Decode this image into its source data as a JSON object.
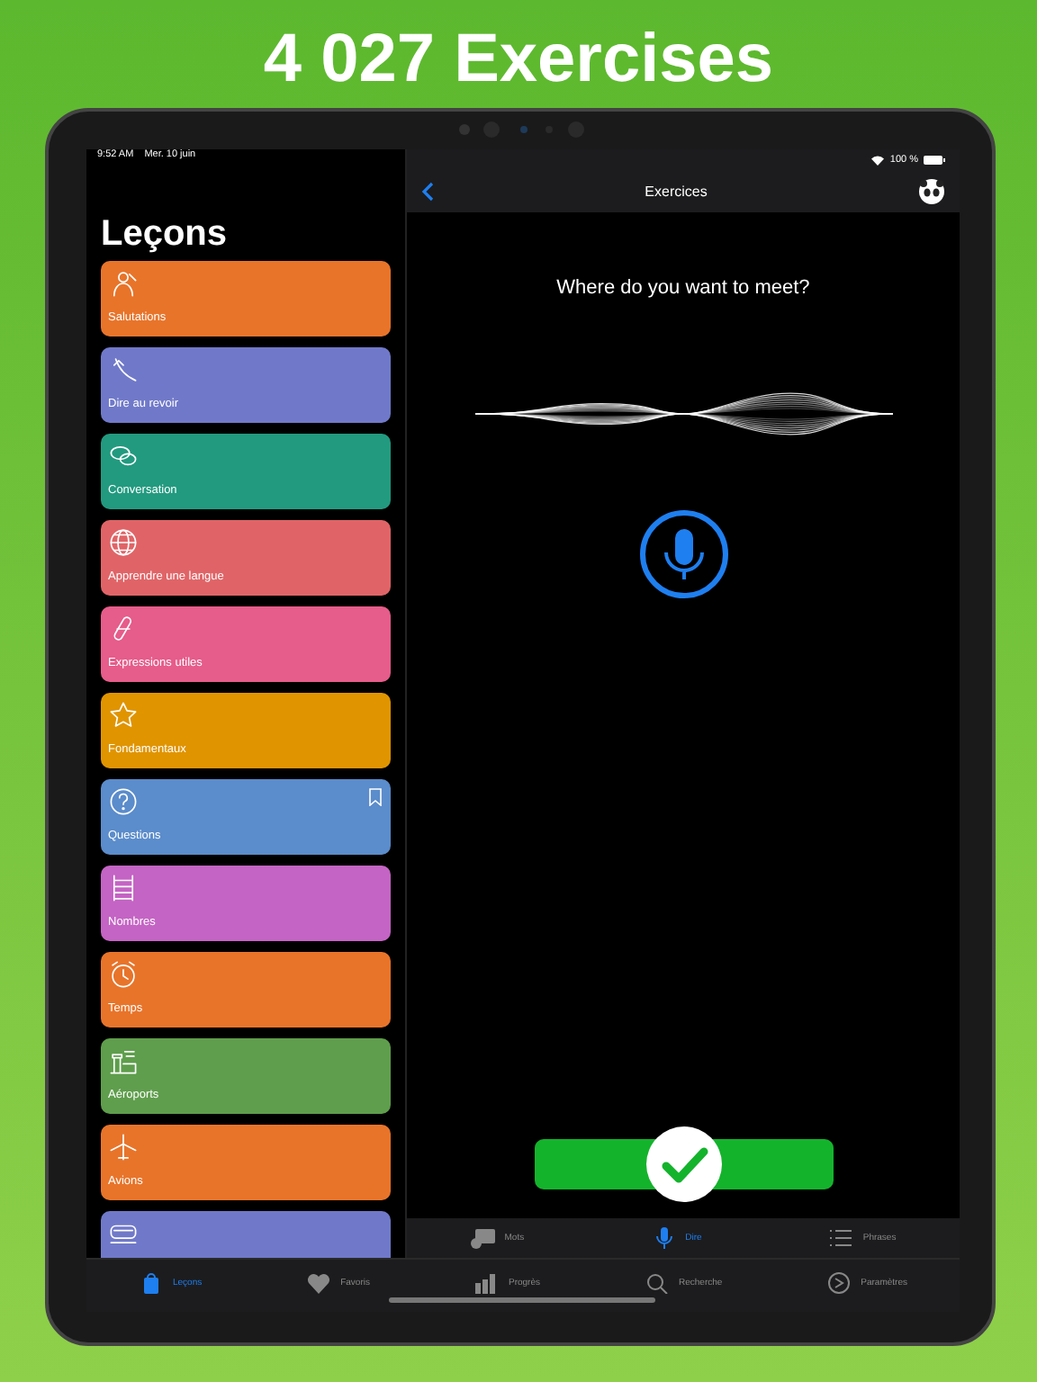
{
  "headline": "4 027 Exercises",
  "status_bar": {
    "time": "9:52 AM",
    "date": "Mer. 10 juin",
    "battery": "100 %"
  },
  "sidebar": {
    "title": "Leçons",
    "lessons": [
      {
        "label": "Salutations",
        "color": "#e8742a",
        "bookmarked": false
      },
      {
        "label": "Dire au revoir",
        "color": "#7079c9",
        "bookmarked": false
      },
      {
        "label": "Conversation",
        "color": "#229a7f",
        "bookmarked": false
      },
      {
        "label": "Apprendre une langue",
        "color": "#e06467",
        "bookmarked": false
      },
      {
        "label": "Expressions utiles",
        "color": "#e65c8a",
        "bookmarked": false
      },
      {
        "label": "Fondamentaux",
        "color": "#e09400",
        "bookmarked": false
      },
      {
        "label": "Questions",
        "color": "#5b8ccb",
        "bookmarked": true
      },
      {
        "label": "Nombres",
        "color": "#c464c4",
        "bookmarked": false
      },
      {
        "label": "Temps",
        "color": "#e8742a",
        "bookmarked": false
      },
      {
        "label": "Aéroports",
        "color": "#5f9e4c",
        "bookmarked": false
      },
      {
        "label": "Avions",
        "color": "#e8742a",
        "bookmarked": false
      },
      {
        "color": "#7079c9",
        "bookmarked": false
      }
    ]
  },
  "exercise": {
    "nav_title": "Exercices",
    "prompt": "Where do you want to meet?"
  },
  "mode_tabs": [
    {
      "label": "Mots",
      "selected": false
    },
    {
      "label": "Dire",
      "selected": true
    },
    {
      "label": "Phrases",
      "selected": false
    }
  ],
  "tab_bar": [
    {
      "label": "Leçons",
      "selected": true
    },
    {
      "label": "Favoris",
      "selected": false
    },
    {
      "label": "Progrès",
      "selected": false
    },
    {
      "label": "Recherche",
      "selected": false
    },
    {
      "label": "Paramètres",
      "selected": false
    }
  ]
}
